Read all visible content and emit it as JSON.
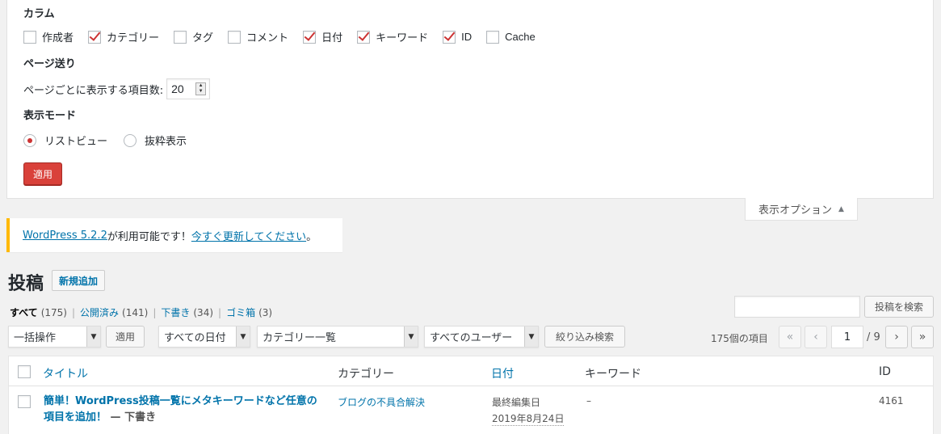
{
  "screen_options": {
    "columns_heading": "カラム",
    "columns": [
      {
        "label": "作成者",
        "checked": false
      },
      {
        "label": "カテゴリー",
        "checked": true
      },
      {
        "label": "タグ",
        "checked": false
      },
      {
        "label": "コメント",
        "checked": false
      },
      {
        "label": "日付",
        "checked": true
      },
      {
        "label": "キーワード",
        "checked": true
      },
      {
        "label": "ID",
        "checked": true
      },
      {
        "label": "Cache",
        "checked": false
      }
    ],
    "pagination_heading": "ページ送り",
    "per_page_label": "ページごとに表示する項目数:",
    "per_page_value": "20",
    "view_mode_heading": "表示モード",
    "view_modes": [
      {
        "label": "リストビュー",
        "checked": true
      },
      {
        "label": "抜粋表示",
        "checked": false
      }
    ],
    "apply_label": "適用",
    "tab_label": "表示オプション",
    "tab_arrow": "▲"
  },
  "notice": {
    "link_version": "WordPress 5.2.2",
    "text_middle": " が利用可能です！",
    "link_update": "今すぐ更新してください",
    "text_end": "。"
  },
  "page": {
    "title": "投稿",
    "add_new_label": "新規追加"
  },
  "filters": {
    "all": "すべて",
    "all_count": "(175)",
    "published": "公開済み",
    "published_count": "(141)",
    "draft": "下書き",
    "draft_count": "(34)",
    "trash": "ゴミ箱",
    "trash_count": "(3)",
    "separator": "|"
  },
  "search": {
    "value": "",
    "button_label": "投稿を検索"
  },
  "tablenav": {
    "bulk_action": "一括操作",
    "apply_label": "適用",
    "date_filter": "すべての日付",
    "category_filter": "カテゴリー一覧",
    "user_filter": "すべてのユーザー",
    "filter_button": "絞り込み検索",
    "items_count": "175個の項目",
    "first": "«",
    "prev": "‹",
    "current_page": "1",
    "total_pages": "/ 9",
    "next": "›",
    "last": "»"
  },
  "table": {
    "headers": {
      "title": "タイトル",
      "category": "カテゴリー",
      "date": "日付",
      "keyword": "キーワード",
      "id": "ID"
    },
    "rows": [
      {
        "title": "簡単！WordPress投稿一覧にメタキーワードなど任意の項目を追加！",
        "state": " — 下書き",
        "category": "ブログの不具合解決",
        "date_label": "最終編集日",
        "date": "2019年8月24日",
        "keyword": "–",
        "id": "4161"
      }
    ]
  },
  "colors": {
    "accent": "#0073aa",
    "apply_button": "#d9413a",
    "checkbox_check": "#cc3333",
    "notice_border": "#ffb900"
  }
}
